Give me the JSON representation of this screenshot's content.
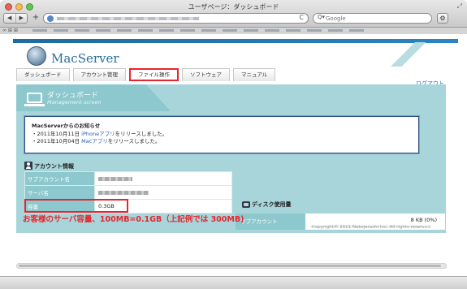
{
  "window": {
    "title": "ユーザページ：ダッシュボード"
  },
  "toolbar": {
    "back_icon": "◀",
    "forward_icon": "▶",
    "add_icon": "+",
    "reload_icon": "C",
    "search_placeholder": "Google",
    "search_glyph": "Q▾",
    "settings_icon": "⚙",
    "bookmark_icons": "∞ ⊞ ⊞"
  },
  "site": {
    "logo": "MacServer",
    "logout": "ログアウト"
  },
  "tabs": [
    {
      "label": "ダッシュボード"
    },
    {
      "label": "アカウント管理"
    },
    {
      "label": "ファイル操作"
    },
    {
      "label": "ソフトウェア"
    },
    {
      "label": "マニュアル"
    }
  ],
  "dashboard": {
    "title": "ダッシュボード",
    "subtitle": "Management screen"
  },
  "notice": {
    "title": "MacServerからのお知らせ",
    "items": [
      {
        "prefix": "・2011年10月11日 ",
        "link": "iPhoneアプリ",
        "suffix": "をリリースしました。"
      },
      {
        "prefix": "・2011年10月04日 ",
        "link": "Macアプリ",
        "suffix": "をリリースしました。"
      }
    ]
  },
  "account": {
    "title": "アカウント情報",
    "rows": [
      {
        "key": "サブアカウント名",
        "value": ""
      },
      {
        "key": "サーバ名",
        "value": ""
      },
      {
        "key": "容量",
        "value": "0.3GB"
      }
    ]
  },
  "disk": {
    "title": "ディスク使用量",
    "label": "サブアカウント",
    "value": "8 KB (0%)",
    "usage_percent": 0
  },
  "caption": "お客様のサーバ容量、100MB=0.1GB（上記例では 300MB)",
  "copyright": "Copyright© 2011 Nekojarashi Inc. All rights reserved.",
  "colors": {
    "accent": "#a7d5d9",
    "highlight": "#e8252c",
    "link": "#2a6eb8"
  }
}
